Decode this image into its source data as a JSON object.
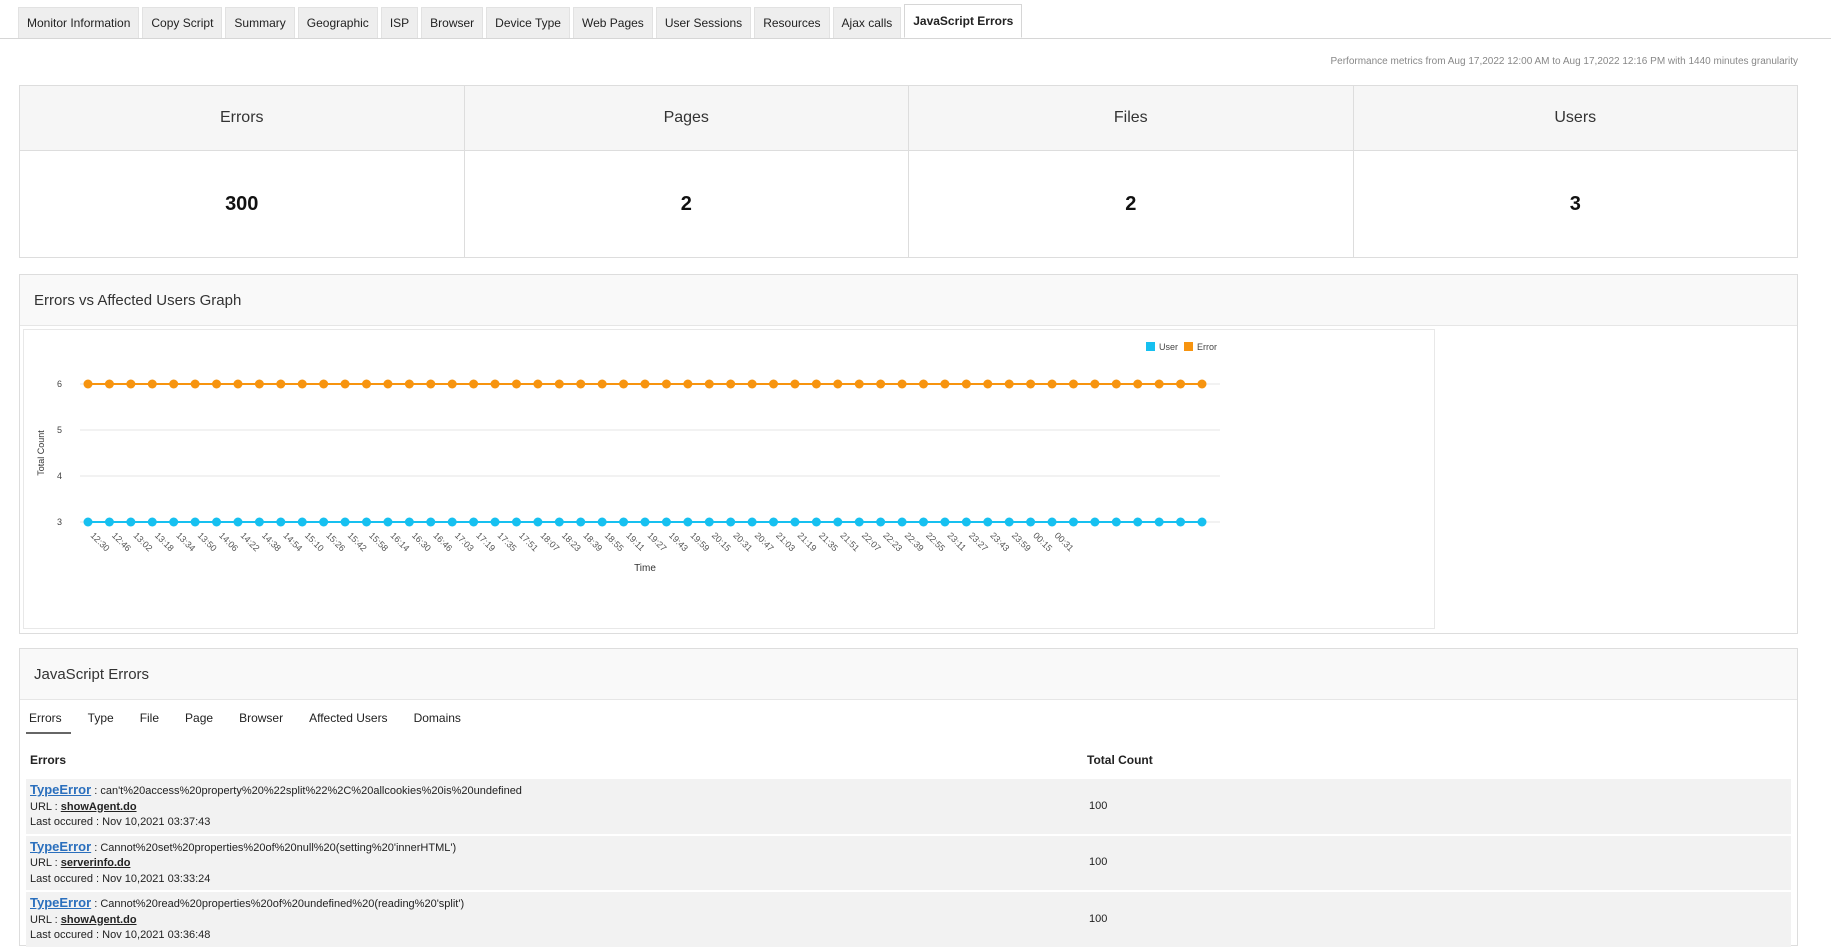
{
  "tabs": [
    {
      "label": "Monitor Information",
      "active": false
    },
    {
      "label": "Copy Script",
      "active": false
    },
    {
      "label": "Summary",
      "active": false
    },
    {
      "label": "Geographic",
      "active": false
    },
    {
      "label": "ISP",
      "active": false
    },
    {
      "label": "Browser",
      "active": false
    },
    {
      "label": "Device Type",
      "active": false
    },
    {
      "label": "Web Pages",
      "active": false
    },
    {
      "label": "User Sessions",
      "active": false
    },
    {
      "label": "Resources",
      "active": false
    },
    {
      "label": "Ajax calls",
      "active": false
    },
    {
      "label": "JavaScript Errors",
      "active": true
    }
  ],
  "metrics_note": "Performance metrics from Aug 17,2022 12:00 AM to Aug 17,2022 12:16 PM with 1440 minutes granularity",
  "stats": [
    {
      "label": "Errors",
      "value": "300"
    },
    {
      "label": "Pages",
      "value": "2"
    },
    {
      "label": "Files",
      "value": "2"
    },
    {
      "label": "Users",
      "value": "3"
    }
  ],
  "graph_panel": {
    "title": "Errors vs Affected Users Graph"
  },
  "chart_data": {
    "type": "line",
    "title": "",
    "xlabel": "Time",
    "ylabel": "Total Count",
    "ylim": [
      3,
      6
    ],
    "yticks": [
      "3",
      "4",
      "5",
      "6"
    ],
    "grid": true,
    "legend_position": "top-right",
    "categories": [
      "12:30",
      "12:46",
      "13:02",
      "13:18",
      "13:34",
      "13:50",
      "14:06",
      "14:22",
      "14:38",
      "14:54",
      "15:10",
      "15:26",
      "15:42",
      "15:58",
      "16:14",
      "16:30",
      "16:46",
      "17:03",
      "17:19",
      "17:35",
      "17:51",
      "18:07",
      "18:23",
      "18:39",
      "18:55",
      "19:11",
      "19:27",
      "19:43",
      "19:59",
      "20:15",
      "20:31",
      "20:47",
      "21:03",
      "21:19",
      "21:35",
      "21:51",
      "22:07",
      "22:23",
      "22:39",
      "22:55",
      "23:11",
      "23:27",
      "23:43",
      "23:59",
      "00:15",
      "00:31"
    ],
    "series": [
      {
        "name": "User",
        "color": "#16c0f0",
        "values": [
          3,
          3,
          3,
          3,
          3,
          3,
          3,
          3,
          3,
          3,
          3,
          3,
          3,
          3,
          3,
          3,
          3,
          3,
          3,
          3,
          3,
          3,
          3,
          3,
          3,
          3,
          3,
          3,
          3,
          3,
          3,
          3,
          3,
          3,
          3,
          3,
          3,
          3,
          3,
          3,
          3,
          3,
          3,
          3,
          3,
          3,
          3,
          3,
          3,
          3,
          3,
          3,
          3
        ]
      },
      {
        "name": "Error",
        "color": "#f7940f",
        "values": [
          6,
          6,
          6,
          6,
          6,
          6,
          6,
          6,
          6,
          6,
          6,
          6,
          6,
          6,
          6,
          6,
          6,
          6,
          6,
          6,
          6,
          6,
          6,
          6,
          6,
          6,
          6,
          6,
          6,
          6,
          6,
          6,
          6,
          6,
          6,
          6,
          6,
          6,
          6,
          6,
          6,
          6,
          6,
          6,
          6,
          6,
          6,
          6,
          6,
          6,
          6,
          6,
          6
        ]
      }
    ]
  },
  "errors_panel": {
    "title": "JavaScript Errors",
    "subtabs": [
      "Errors",
      "Type",
      "File",
      "Page",
      "Browser",
      "Affected Users",
      "Domains"
    ],
    "columns": [
      "Errors",
      "Total Count"
    ],
    "url_label": "URL : ",
    "last_label": "Last occured : ",
    "rows": [
      {
        "type": "TypeError",
        "message": " : can't%20access%20property%20%22split%22%2C%20allcookies%20is%20undefined",
        "url": "showAgent.do",
        "last": "Nov 10,2021 03:37:43",
        "count": "100"
      },
      {
        "type": "TypeError",
        "message": " : Cannot%20set%20properties%20of%20null%20(setting%20'innerHTML')",
        "url": "serverinfo.do",
        "last": "Nov 10,2021 03:33:24",
        "count": "100"
      },
      {
        "type": "TypeError",
        "message": " : Cannot%20read%20properties%20of%20undefined%20(reading%20'split')",
        "url": "showAgent.do",
        "last": "Nov 10,2021 03:36:48",
        "count": "100"
      }
    ]
  }
}
